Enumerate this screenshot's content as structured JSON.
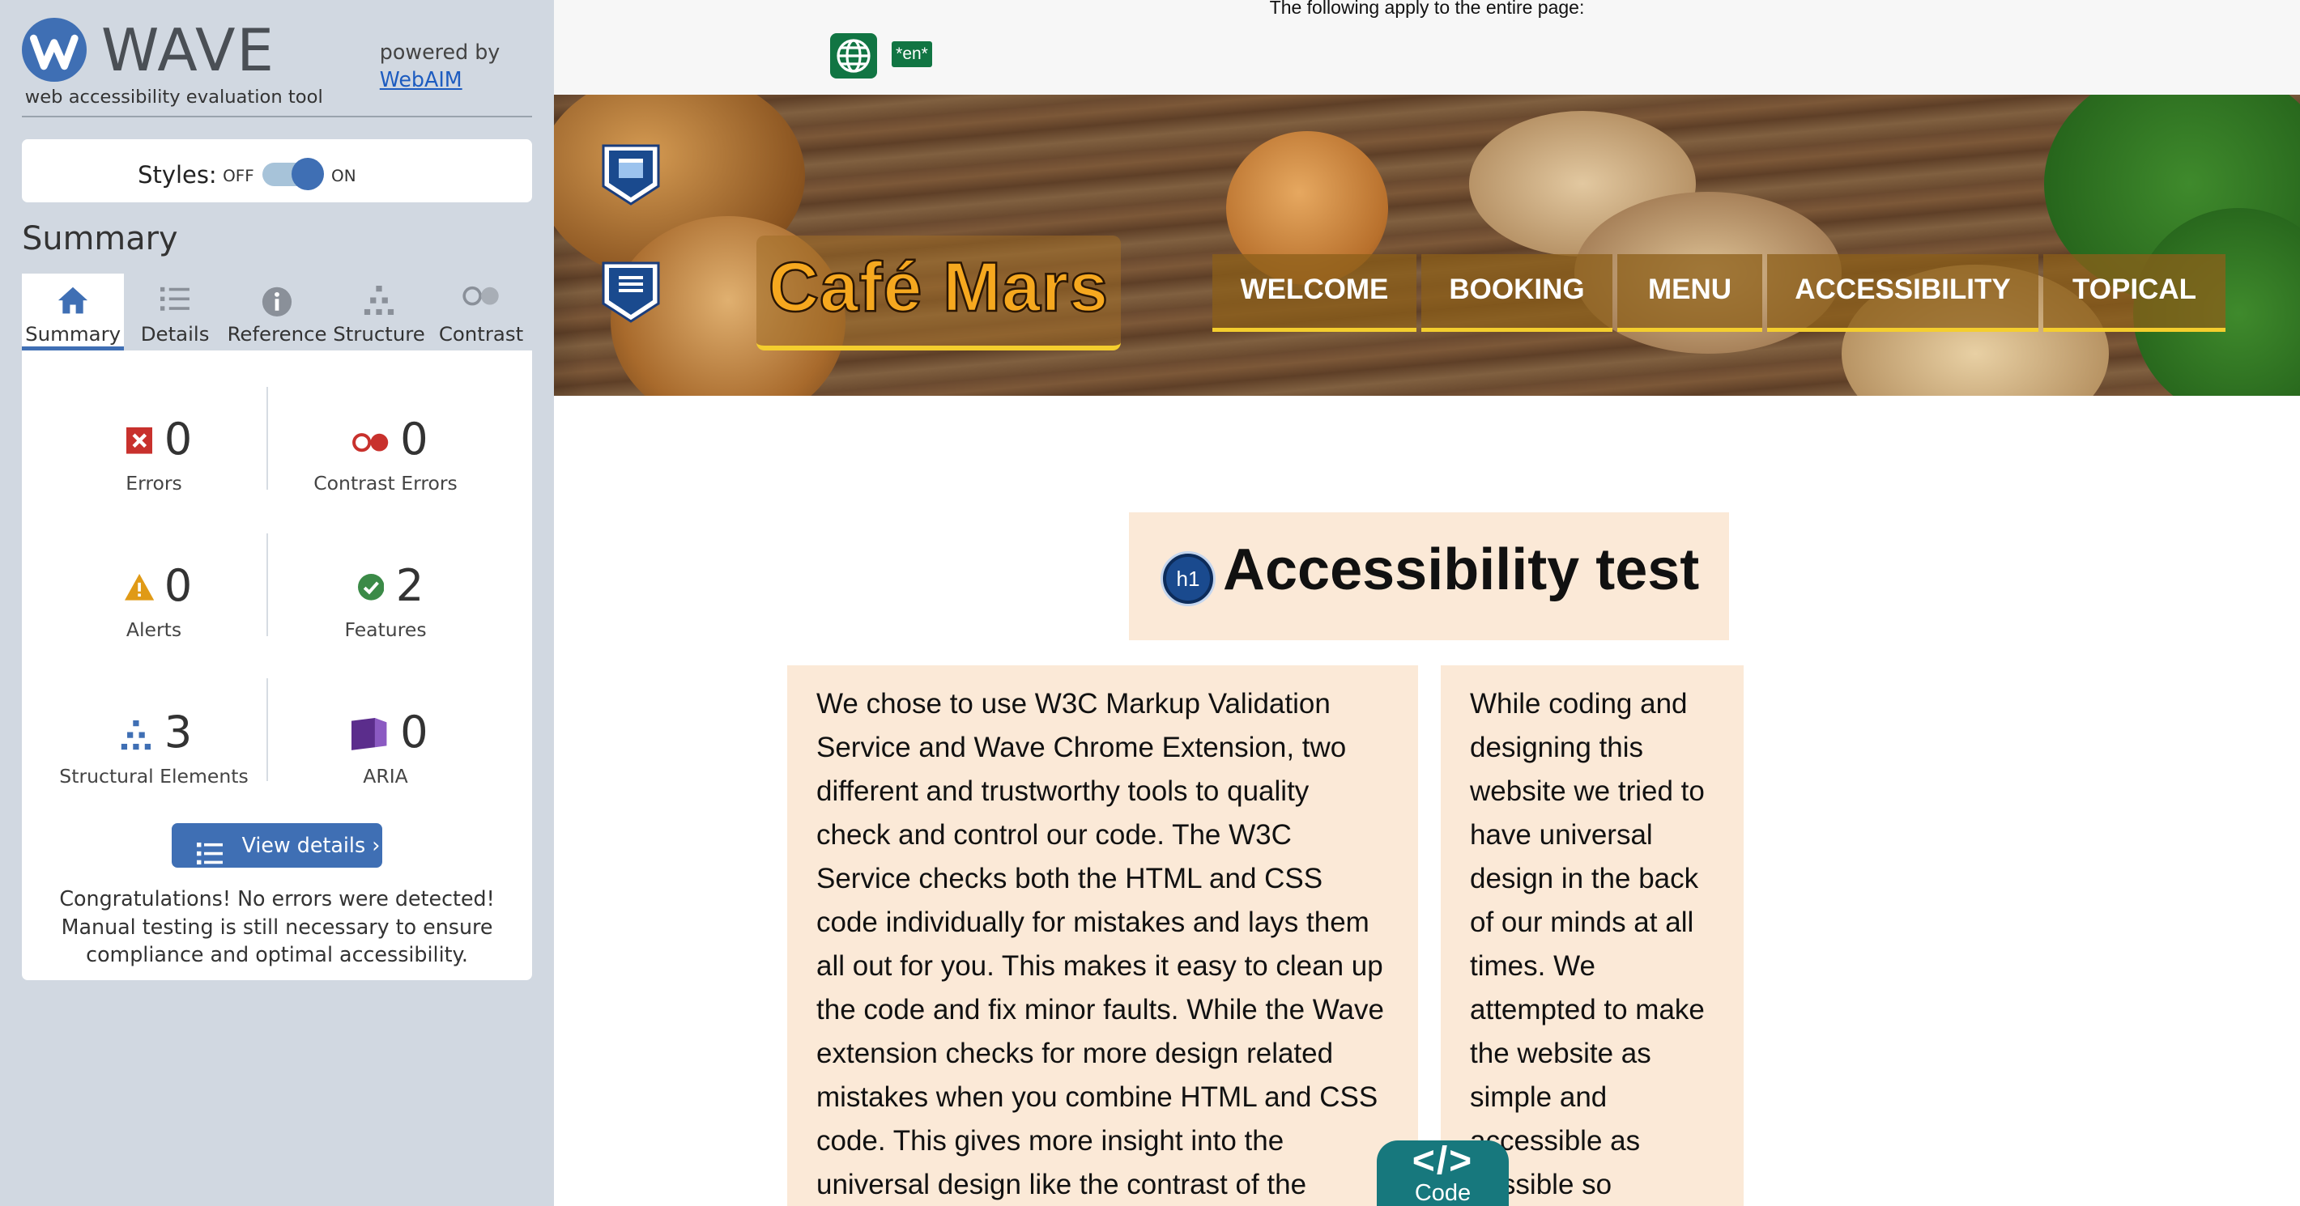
{
  "wave": {
    "logo_text": "WAVE",
    "tagline": "web accessibility evaluation tool",
    "powered_by": "powered by",
    "powered_link": "WebAIM",
    "styles_label": "Styles:",
    "styles_off": "OFF",
    "styles_on": "ON",
    "styles_enabled": true,
    "summary_heading": "Summary",
    "tabs": [
      {
        "label": "Summary",
        "icon": "home-icon",
        "active": true
      },
      {
        "label": "Details",
        "icon": "list-icon",
        "active": false
      },
      {
        "label": "Reference",
        "icon": "info-icon",
        "active": false
      },
      {
        "label": "Structure",
        "icon": "structure-icon",
        "active": false
      },
      {
        "label": "Contrast",
        "icon": "contrast-icon",
        "active": false
      }
    ],
    "stats": {
      "errors": {
        "value": "0",
        "label": "Errors",
        "icon": "error-icon",
        "color": "#c8312d"
      },
      "contrast": {
        "value": "0",
        "label": "Contrast Errors",
        "icon": "contrast-error-icon",
        "color": "#c8312d"
      },
      "alerts": {
        "value": "0",
        "label": "Alerts",
        "icon": "alert-icon",
        "color": "#e09a16"
      },
      "features": {
        "value": "2",
        "label": "Features",
        "icon": "feature-icon",
        "color": "#3b8a47"
      },
      "structural": {
        "value": "3",
        "label": "Structural Elements",
        "icon": "structure-icon",
        "color": "#3f6fb4"
      },
      "aria": {
        "value": "0",
        "label": "ARIA",
        "icon": "aria-icon",
        "color": "#5b2d8c"
      }
    },
    "view_details": "View details ›",
    "congrats": "Congratulations! No errors were detected! Manual testing is still necessary to ensure compliance and optimal accessibility."
  },
  "page": {
    "top_note": "The following apply to the entire page:",
    "lang_badge": "*en*",
    "site_title": "Café Mars",
    "nav": [
      "WELCOME",
      "BOOKING",
      "MENU",
      "ACCESSIBILITY",
      "TOPICAL"
    ],
    "h1_badge": "h1",
    "h1": "Accessibility test",
    "col1_text": "We chose to use W3C Markup Validation Service and Wave Chrome Extension, two different and trustworthy tools to quality check and control our code. The W3C Service checks both the HTML and CSS code individually for mistakes and lays them all out for you. This makes it easy to clean up the code and fix minor faults. While the Wave extension checks for more design related mistakes when you combine HTML and CSS code. This gives more insight into the universal design like the contrast of the",
    "col2_text": "While coding and designing this website we tried to have universal design in the back of our minds at all times. We attempted to make the website as simple and accessible as possible so",
    "code_symbol": "</>",
    "code_label": "Code"
  },
  "colors": {
    "wave_blue": "#3f6fb4",
    "panel_bg": "#d1d8e1",
    "page_box": "#fbe9d7",
    "wave_green": "#117543",
    "code_teal": "#17787d",
    "title_orange": "#f6a81f",
    "nav_underline": "#f4ce2e"
  }
}
